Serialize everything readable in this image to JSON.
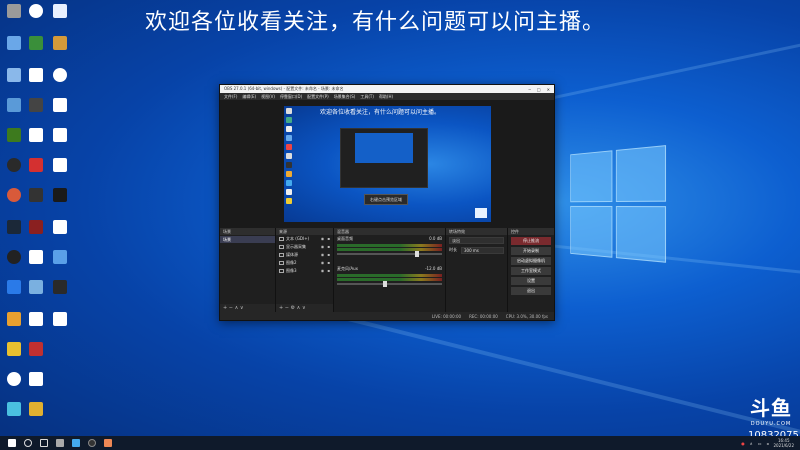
{
  "banner": {
    "text": "欢迎各位收看关注，有什么问题可以问主播。"
  },
  "obs": {
    "title": "OBS 27.0.1 (64-bit, windows) - 配置文件: 未命名 - 场景: 未命名",
    "menu": [
      "文件(F)",
      "编辑(E)",
      "视图(V)",
      "停靠窗口(D)",
      "配置文件(P)",
      "场景集合(S)",
      "工具(T)",
      "帮助(H)"
    ],
    "preview_banner": "欢迎各位收看关注，有什么问题可以问主播。",
    "preview_tooltip": "右键点击预览区域",
    "docks": {
      "scenes": {
        "header": "场景",
        "items": [
          "场景"
        ]
      },
      "sources": {
        "header": "来源",
        "items": [
          {
            "name": "文本 (GDI+)",
            "icon": "text-icon"
          },
          {
            "name": "显示器采集",
            "icon": "monitor-icon"
          },
          {
            "name": "媒体源",
            "icon": "media-icon"
          },
          {
            "name": "图像2",
            "icon": "image-icon"
          },
          {
            "name": "图像3",
            "icon": "image-icon"
          }
        ]
      },
      "mixer": {
        "header": "混音器",
        "channels": [
          {
            "name": "桌面音频",
            "level": "0.0 dB"
          },
          {
            "name": "麦克风/Aux",
            "level": "-12.0 dB"
          }
        ]
      },
      "transitions": {
        "header": "转场特效",
        "type": "淡出",
        "duration_label": "时长",
        "duration": "300 ms"
      },
      "controls": {
        "header": "控件",
        "buttons": [
          "停止推流",
          "开始录制",
          "启动虚拟摄像机",
          "工作室模式",
          "设置",
          "退出"
        ]
      }
    },
    "status": {
      "live": "LIVE: 00:00:00",
      "rec": "REC: 00:00:00",
      "cpu": "CPU: 3.0%, 30.00 fps"
    }
  },
  "watermark": {
    "logo": "斗鱼",
    "sub": "DOUYU.COM",
    "room": "10832075"
  },
  "taskbar": {
    "time": "16:45",
    "date": "2021/6/22"
  },
  "colors": {
    "accent": "#0d5fd0",
    "obs_bg": "#1e1e1e",
    "stop_button": "#7a2a2e"
  }
}
